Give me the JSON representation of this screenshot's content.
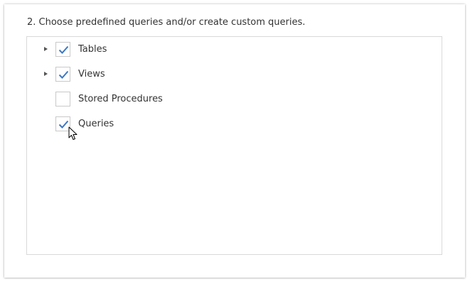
{
  "step": {
    "instruction": "2. Choose predefined queries and/or create custom queries."
  },
  "tree": {
    "items": [
      {
        "label": "Tables",
        "checked": true,
        "expandable": true
      },
      {
        "label": "Views",
        "checked": true,
        "expandable": true
      },
      {
        "label": "Stored Procedures",
        "checked": false,
        "expandable": false
      },
      {
        "label": "Queries",
        "checked": true,
        "expandable": false
      }
    ]
  },
  "colors": {
    "checkmark": "#3b78c2",
    "checkbox_border": "#c9c9c9",
    "panel_border": "#d9d9d9"
  },
  "icons": {
    "expander": "triangle-right-icon",
    "check": "checkmark-icon",
    "cursor": "mouse-pointer-icon"
  }
}
